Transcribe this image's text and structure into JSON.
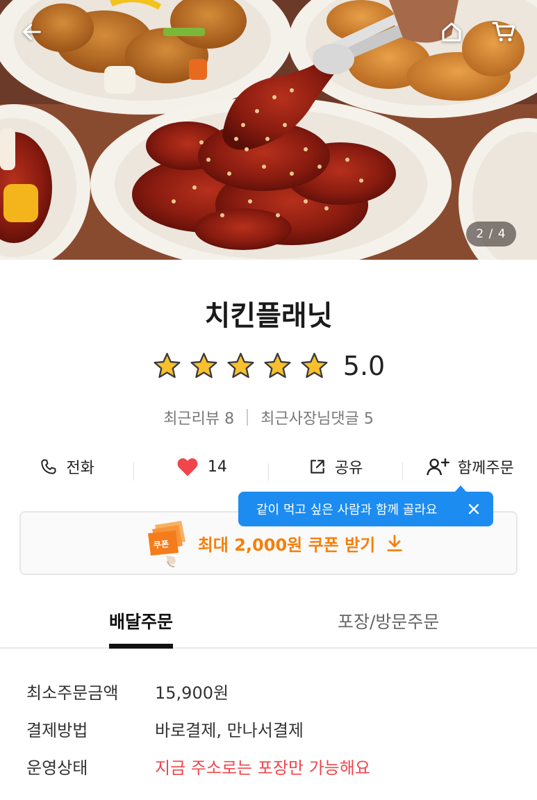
{
  "hero": {
    "counter": "2 / 4",
    "back_icon": "arrow-left-icon",
    "home_icon": "home-icon",
    "cart_icon": "cart-icon"
  },
  "store": {
    "name": "치킨플래닛",
    "rating": 5.0,
    "rating_text": "5.0",
    "stars_filled": 5,
    "stars_total": 5,
    "recent_reviews": "최근리뷰 8",
    "owner_comments": "최근사장님댓글 5"
  },
  "actions": {
    "call_label": "전화",
    "like_count": "14",
    "share_label": "공유",
    "group_order_label": "함께주문"
  },
  "tooltip": {
    "text": "같이 먹고 싶은 사람과 함께 골라요"
  },
  "coupon": {
    "badge_text": "쿠폰",
    "label": "최대 2,000원 쿠폰 받기"
  },
  "tabs": [
    {
      "label": "배달주문",
      "active": true
    },
    {
      "label": "포장/방문주문",
      "active": false
    }
  ],
  "info": {
    "min_order_label": "최소주문금액",
    "min_order_value": "15,900원",
    "payment_label": "결제방법",
    "payment_value": "바로결제, 만나서결제",
    "status_label": "운영상태",
    "status_value": "지금 주소로는 포장만 가능해요"
  },
  "colors": {
    "accent_blue": "#1c8cf1",
    "coupon_orange": "#f77f0a",
    "warning_red": "#f0464b",
    "heart_red": "#f0464b",
    "star_yellow": "#f7c02c"
  }
}
